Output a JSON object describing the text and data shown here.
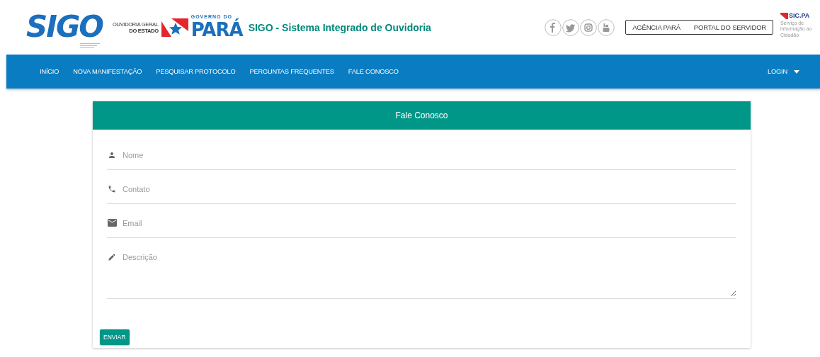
{
  "header": {
    "logo": "SIGO",
    "ouvidoria_lines": [
      "OUVIDORIA GERAL",
      "DO ESTADO"
    ],
    "governo_label": "GOVERNO DO",
    "governo_name": "PARÁ",
    "site_title": "SIGO - Sistema Integrado de Ouvidoria",
    "links": [
      "AGÊNCIA PARÁ",
      "PORTAL DO SERVIDOR"
    ],
    "sic_logo": "SIC.PA",
    "sic_caption": [
      "Serviço de",
      "informação ao",
      "Cidadão"
    ]
  },
  "nav": {
    "items": [
      {
        "label": "INÍCIO"
      },
      {
        "label": "NOVA MANIFESTAÇÃO"
      },
      {
        "label": "PESQUISAR PROTOCOLO"
      },
      {
        "label": "PERGUNTAS FREQUENTES"
      },
      {
        "label": "FALE CONOSCO"
      }
    ],
    "login": "LOGIN"
  },
  "form": {
    "title": "Fale Conosco",
    "fields": [
      {
        "kind": "text",
        "placeholder": "Nome"
      },
      {
        "kind": "text",
        "placeholder": "Contato"
      },
      {
        "kind": "text",
        "placeholder": "Email"
      },
      {
        "kind": "textarea",
        "placeholder": "Descrição"
      }
    ],
    "submit": "ENVIAR"
  }
}
